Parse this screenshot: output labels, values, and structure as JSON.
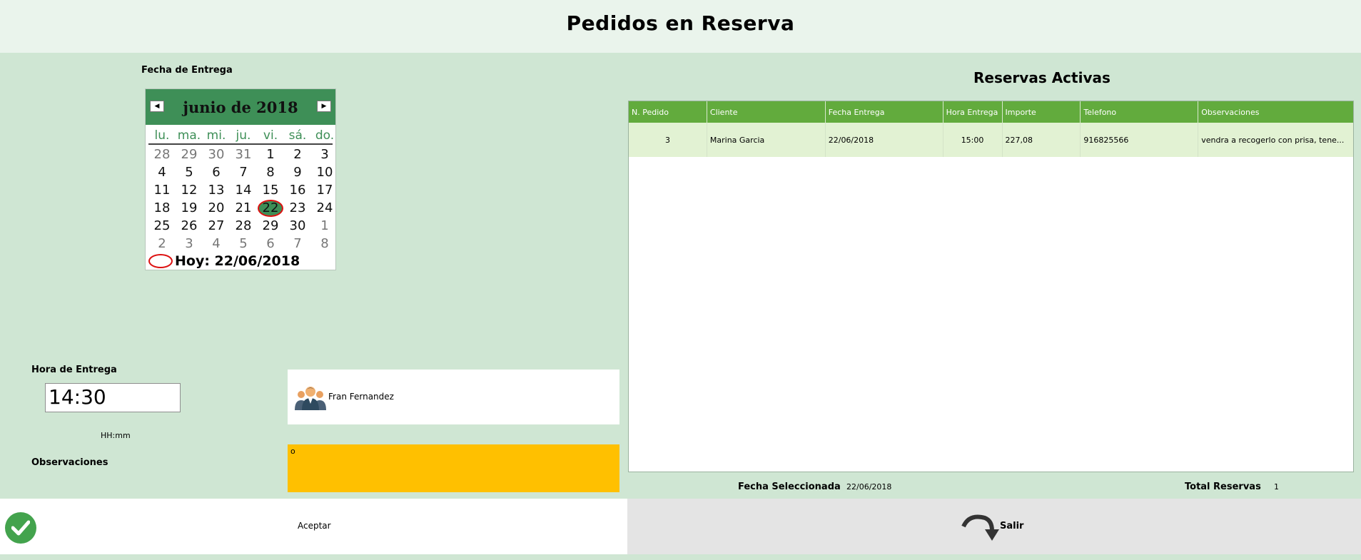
{
  "header": {
    "title": "Pedidos en Reserva"
  },
  "labels": {
    "delivery_date": "Fecha de Entrega",
    "delivery_time": "Hora de Entrega",
    "time_format": "HH:mm",
    "observations": "Observaciones",
    "selected_date": "Fecha Seleccionada",
    "total_reservations": "Total Reservas"
  },
  "calendar": {
    "month_title": "junio de 2018",
    "weekdays": [
      "lu.",
      "ma.",
      "mi.",
      "ju.",
      "vi.",
      "sá.",
      "do."
    ],
    "days": [
      {
        "d": "28",
        "other": true
      },
      {
        "d": "29",
        "other": true
      },
      {
        "d": "30",
        "other": true
      },
      {
        "d": "31",
        "other": true
      },
      {
        "d": "1"
      },
      {
        "d": "2"
      },
      {
        "d": "3"
      },
      {
        "d": "4"
      },
      {
        "d": "5"
      },
      {
        "d": "6"
      },
      {
        "d": "7"
      },
      {
        "d": "8"
      },
      {
        "d": "9"
      },
      {
        "d": "10"
      },
      {
        "d": "11"
      },
      {
        "d": "12"
      },
      {
        "d": "13"
      },
      {
        "d": "14"
      },
      {
        "d": "15"
      },
      {
        "d": "16"
      },
      {
        "d": "17"
      },
      {
        "d": "18"
      },
      {
        "d": "19"
      },
      {
        "d": "20"
      },
      {
        "d": "21"
      },
      {
        "d": "22",
        "selected": true
      },
      {
        "d": "23"
      },
      {
        "d": "24"
      },
      {
        "d": "25"
      },
      {
        "d": "26"
      },
      {
        "d": "27"
      },
      {
        "d": "28"
      },
      {
        "d": "29"
      },
      {
        "d": "30"
      },
      {
        "d": "1",
        "other": true
      },
      {
        "d": "2",
        "other": true
      },
      {
        "d": "3",
        "other": true
      },
      {
        "d": "4",
        "other": true
      },
      {
        "d": "5",
        "other": true
      },
      {
        "d": "6",
        "other": true
      },
      {
        "d": "7",
        "other": true
      },
      {
        "d": "8",
        "other": true
      }
    ],
    "today_label": "Hoy: 22/06/2018",
    "accent_color": "#3e8f57"
  },
  "time_input": {
    "value": "14:30"
  },
  "user": {
    "name": "Fran Fernandez"
  },
  "observations_input": {
    "value": "o",
    "bg_color": "#ffc000"
  },
  "actions": {
    "accept_label": "Aceptar",
    "exit_label": "Salir"
  },
  "reservations": {
    "title": "Reservas Activas",
    "columns": [
      "N. Pedido",
      "Cliente",
      "Fecha Entrega",
      "Hora Entrega",
      "Importe",
      "Telefono",
      "Observaciones"
    ],
    "rows": [
      [
        "3",
        "Marina Garcia",
        "22/06/2018",
        "15:00",
        "227,08",
        "916825566",
        "vendra a recogerlo con prisa, tene..."
      ]
    ],
    "header_color": "#62ab3d"
  },
  "footer": {
    "selected_date_value": "22/06/2018",
    "total_value": "1"
  }
}
